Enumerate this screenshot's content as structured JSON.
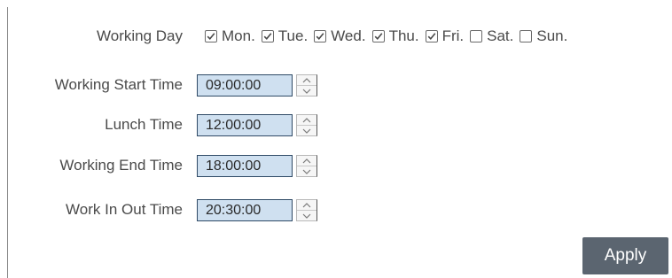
{
  "working_day": {
    "label": "Working Day",
    "days": [
      {
        "label": "Mon.",
        "checked": true
      },
      {
        "label": "Tue.",
        "checked": true
      },
      {
        "label": "Wed.",
        "checked": true
      },
      {
        "label": "Thu.",
        "checked": true
      },
      {
        "label": "Fri.",
        "checked": true
      },
      {
        "label": "Sat.",
        "checked": false
      },
      {
        "label": "Sun.",
        "checked": false
      }
    ]
  },
  "fields": {
    "start": {
      "label": "Working Start Time",
      "value": "09:00:00"
    },
    "lunch": {
      "label": "Lunch Time",
      "value": "12:00:00"
    },
    "end": {
      "label": "Working End Time",
      "value": "18:00:00"
    },
    "inout": {
      "label": "Work In Out Time",
      "value": "20:30:00"
    }
  },
  "apply_label": "Apply",
  "colors": {
    "input_bg": "#cfe0f0",
    "input_border": "#2f4a66",
    "button_bg": "#5b6570"
  }
}
